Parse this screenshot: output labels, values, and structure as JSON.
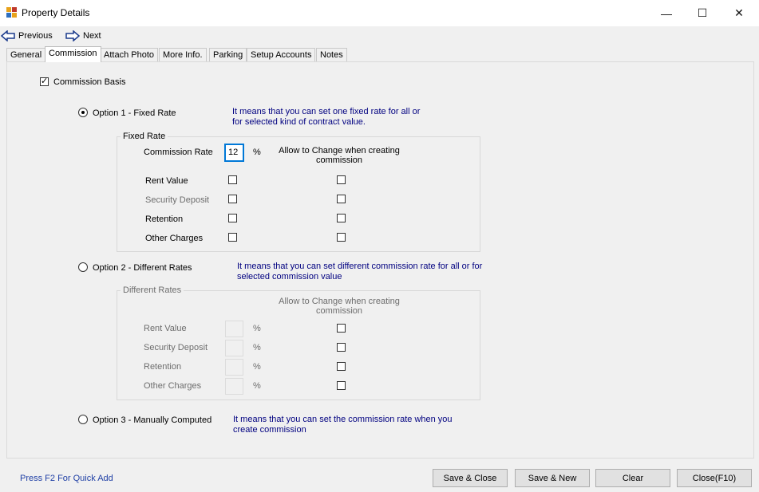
{
  "window": {
    "title": "Property Details",
    "minimize": "—",
    "maximize": "☐",
    "close": "✕"
  },
  "nav": {
    "previous": "Previous",
    "next": "Next"
  },
  "tabs": [
    "General",
    "Commission",
    "Attach Photo",
    "More Info.",
    "Parking",
    "Setup Accounts",
    "Notes"
  ],
  "active_tab": "Commission",
  "commission_basis": {
    "label": "Commission Basis",
    "checked": true
  },
  "option1": {
    "label": "Option 1 - Fixed Rate",
    "selected": true,
    "desc1": "It means that you can set one fixed rate for all or",
    "desc2": "for selected kind of contract value.",
    "group_title": "Fixed Rate",
    "rate_label": "Commission Rate",
    "rate_value": "12",
    "pct": "%",
    "allow_line1": "Allow to Change when creating",
    "allow_line2": "commission",
    "rows": [
      "Rent Value",
      "Security Deposit",
      "Retention",
      "Other Charges"
    ]
  },
  "option2": {
    "label": "Option 2 - Different Rates",
    "selected": false,
    "desc1": "It means that you can set different commission rate for all or for",
    "desc2": "selected commission value",
    "group_title": "Different Rates",
    "allow_line1": "Allow to Change when creating",
    "allow_line2": "commission",
    "pct": "%",
    "rows": [
      "Rent Value",
      "Security Deposit",
      "Retention",
      "Other Charges"
    ]
  },
  "option3": {
    "label": "Option 3 - Manually Computed",
    "selected": false,
    "desc1": "It means that you can set the commission rate when you",
    "desc2": "create commission"
  },
  "footer": {
    "hint": "Press F2 For Quick Add",
    "save_close": "Save & Close",
    "save_new": "Save & New",
    "clear": "Clear",
    "close": "Close(F10)"
  },
  "colors": {
    "accent_blue": "#000080",
    "hint_blue": "#1f3fa5",
    "disabled_gray": "#6d6d6d"
  }
}
